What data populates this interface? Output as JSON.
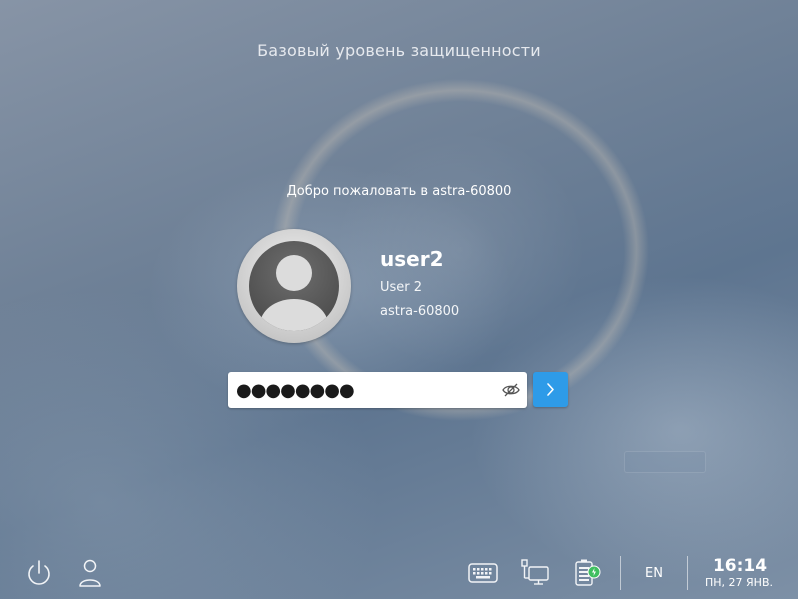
{
  "header": {
    "security_level": "Базовый уровень защищенности"
  },
  "greeter": {
    "welcome": "Добро пожаловать в astra-60800"
  },
  "user": {
    "login": "user2",
    "full_name": "User 2",
    "host": "astra-60800",
    "avatar_icon": "user-avatar-icon"
  },
  "password": {
    "value": "●●●●●●●●",
    "toggle_icon": "eye-slash-icon"
  },
  "submit": {
    "icon": "chevron-right-icon",
    "color": "#2e9be8"
  },
  "bottom_left": {
    "power_icon": "power-icon",
    "switch_user_icon": "user-icon"
  },
  "tray": {
    "keyboard_icon": "keyboard-icon",
    "network_icon": "network-icon",
    "battery_icon": "battery-charging-icon",
    "language": "EN"
  },
  "clock": {
    "time": "16:14",
    "date": "ПН, 27 ЯНВ."
  }
}
